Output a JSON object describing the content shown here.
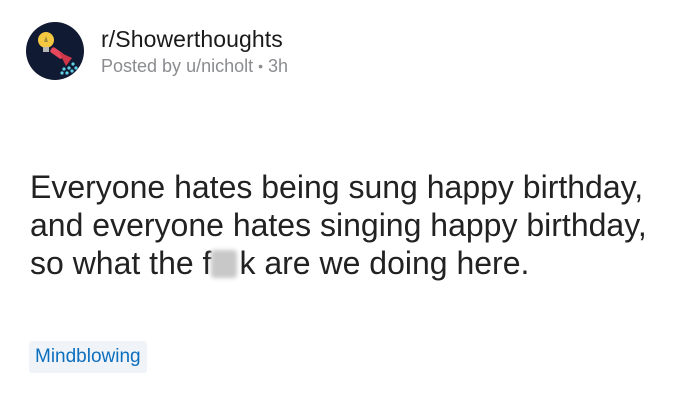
{
  "post": {
    "subreddit": "r/Showerthoughts",
    "byline_prefix": "Posted by",
    "author": "u/nicholt",
    "separator": "•",
    "age": "3h",
    "title_part1": "Everyone hates being sung happy birthday, and everyone hates singing happy birthday, so what the f",
    "title_part2": "k are we doing here.",
    "flair": "Mindblowing",
    "avatar_icon": "shower-head-lightbulb-icon"
  },
  "colors": {
    "avatar_bg": "#101a32",
    "flair_text": "#0c6fbe",
    "flair_bg": "#f0f4f8",
    "meta_text": "#8a8c8f"
  }
}
